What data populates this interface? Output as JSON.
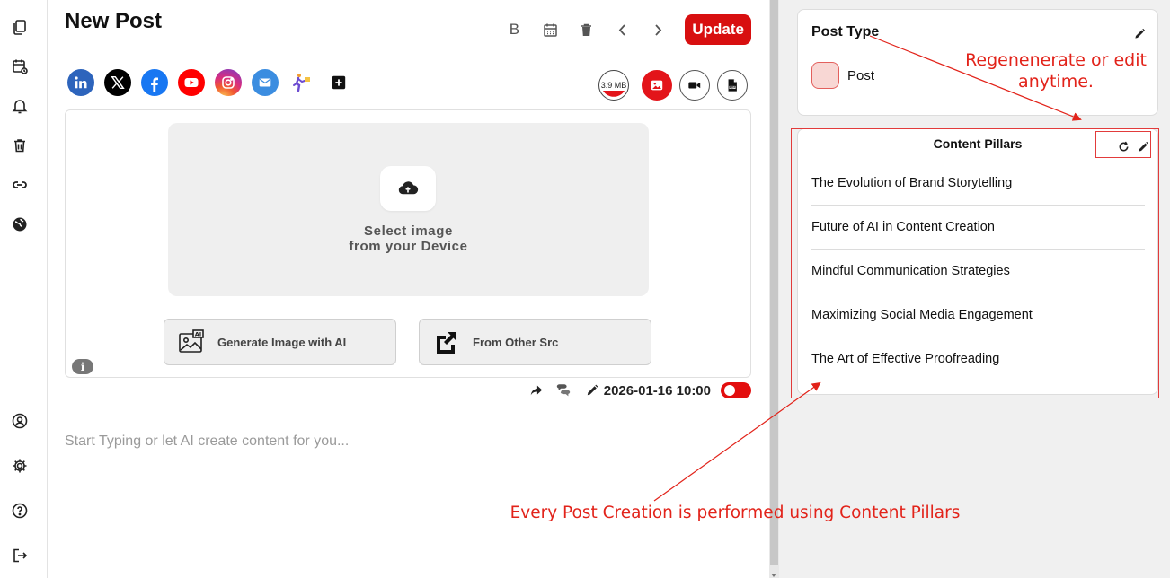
{
  "editor": {
    "title": "New Post",
    "update_label": "Update",
    "upload": {
      "line1": "Select image",
      "line2": "from your Device",
      "generate_label": "Generate Image with AI",
      "other_label": "From Other Src",
      "info_glyph": "i"
    },
    "file_size": "3.9 MB",
    "scheduled_date": "2026-01-16 10:00",
    "compose_placeholder": "Start Typing or let AI create content for you...",
    "bold_glyph": "B",
    "socials": [
      "linkedin-icon",
      "x-icon",
      "facebook-icon",
      "youtube-icon",
      "instagram-icon",
      "email-icon",
      "custom-runner-icon",
      "add-platform-icon"
    ],
    "brand_colors": {
      "linkedin": "#2d64bc",
      "x": "#000000",
      "facebook": "#1877f2",
      "youtube": "#ff0000",
      "email": "#3b8de0",
      "accent": "#d80f10"
    }
  },
  "right_panel": {
    "post_type": {
      "title": "Post Type",
      "value": "Post",
      "swatch_color": "#f8d7d4"
    },
    "content_pillars": {
      "title": "Content Pillars",
      "items": [
        "The Evolution of Brand Storytelling",
        "Future of AI in Content Creation",
        "Mindful Communication Strategies",
        "Maximizing Social Media Engagement",
        "The Art of Effective Proofreading"
      ]
    }
  },
  "annotations": {
    "top_line1": "Regenenerate or edit",
    "top_line2": "anytime.",
    "bottom": "Every Post Creation is performed using Content Pillars",
    "color": "#e2231a"
  }
}
